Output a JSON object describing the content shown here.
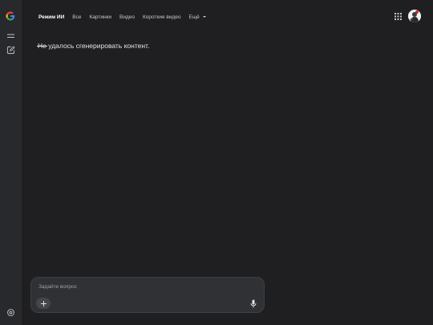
{
  "tabs": [
    {
      "label": "Режим ИИ",
      "active": true
    },
    {
      "label": "Все",
      "active": false
    },
    {
      "label": "Картинки",
      "active": false
    },
    {
      "label": "Видео",
      "active": false
    },
    {
      "label": "Короткие видео",
      "active": false
    }
  ],
  "more_tab": {
    "label": "Ещё"
  },
  "message": {
    "struck": "Не",
    "rest": " удалось сгенерировать контент."
  },
  "composer": {
    "placeholder": "Задайте вопрос"
  },
  "icons": {
    "logo": "google-g-icon",
    "menu": "menu-icon",
    "new_chat": "edit-icon",
    "settings": "settings-icon",
    "apps": "apps-grid-icon",
    "add": "plus-icon",
    "mic": "microphone-icon"
  },
  "colors": {
    "background": "#1f1f21",
    "rail": "#28292c",
    "composer": "#303134",
    "text": "#e3e3e3",
    "muted": "#c4c7c5"
  }
}
